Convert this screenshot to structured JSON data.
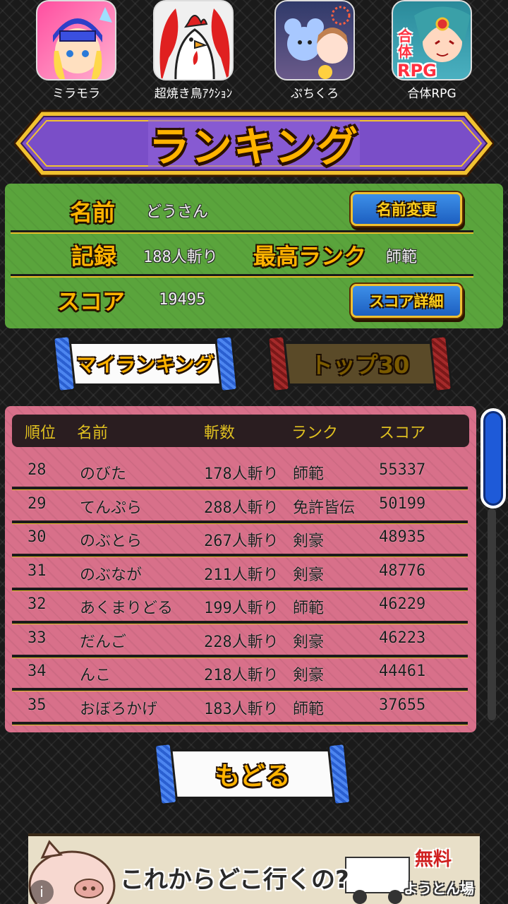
{
  "apps": [
    {
      "label": "ミラモラ",
      "icon": "knight-girl-icon"
    },
    {
      "label": "超焼き鳥ｱｸｼｮﾝ",
      "icon": "rooster-icon"
    },
    {
      "label": "ぷちくろ",
      "icon": "puchikuro-icon"
    },
    {
      "label": "合体RPG",
      "icon": "gattai-rpg-icon",
      "badge": "合体",
      "badge2": "RPG"
    }
  ],
  "banner": {
    "title": "ランキング"
  },
  "profile": {
    "name_label": "名前",
    "name_value": "どうさん",
    "rename_button": "名前変更",
    "record_label": "記録",
    "record_value": "188人斬り",
    "best_rank_label": "最高ランク",
    "best_rank_value": "師範",
    "score_label": "スコア",
    "score_value": "19495",
    "score_detail_button": "スコア詳細"
  },
  "tabs": {
    "my_ranking": "マイランキング",
    "top30": "トップ30"
  },
  "table": {
    "headers": {
      "rank": "順位",
      "name": "名前",
      "kills": "斬数",
      "grade": "ランク",
      "score": "スコア"
    },
    "rows": [
      {
        "rank": "28",
        "name": "のびた",
        "kills": "178人斬り",
        "grade": "師範",
        "score": "55337"
      },
      {
        "rank": "29",
        "name": "てんぷら",
        "kills": "288人斬り",
        "grade": "免許皆伝",
        "score": "50199"
      },
      {
        "rank": "30",
        "name": "のぶとら",
        "kills": "267人斬り",
        "grade": "剣豪",
        "score": "48935"
      },
      {
        "rank": "31",
        "name": "のぶなが",
        "kills": "211人斬り",
        "grade": "剣豪",
        "score": "48776"
      },
      {
        "rank": "32",
        "name": "あくまりどる",
        "kills": "199人斬り",
        "grade": "師範",
        "score": "46229"
      },
      {
        "rank": "33",
        "name": "だんご",
        "kills": "228人斬り",
        "grade": "剣豪",
        "score": "46223"
      },
      {
        "rank": "34",
        "name": "んこ",
        "kills": "218人斬り",
        "grade": "剣豪",
        "score": "44461"
      },
      {
        "rank": "35",
        "name": "おぼろかげ",
        "kills": "183人斬り",
        "grade": "師範",
        "score": "37655"
      }
    ]
  },
  "back_button": "もどる",
  "ad": {
    "text": "これからどこ行くの?",
    "free": "無料",
    "brand": "ようとん場",
    "info": "i"
  }
}
